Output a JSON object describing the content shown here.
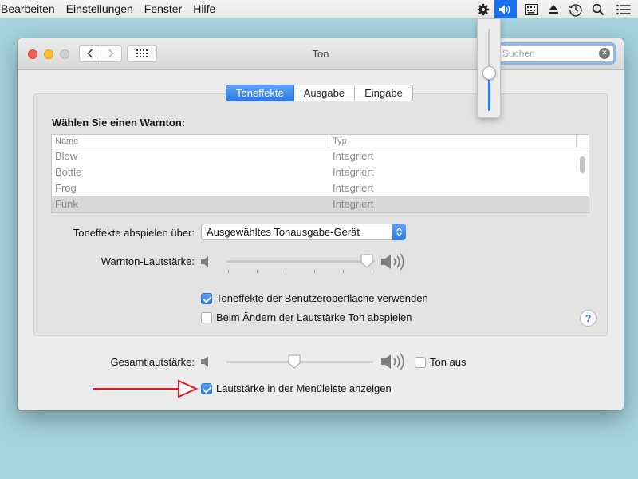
{
  "menubar": {
    "items": [
      "Bearbeiten",
      "Einstellungen",
      "Fenster",
      "Hilfe"
    ],
    "status_icons": [
      "gear-icon",
      "volume-icon",
      "keyboard-viewer-icon",
      "eject-icon",
      "time-machine-icon",
      "spotlight-search-icon",
      "notification-center-icon"
    ]
  },
  "volume_popup": {
    "level": 0.47
  },
  "window": {
    "title": "Ton",
    "search": {
      "placeholder": "Suchen",
      "value": ""
    }
  },
  "tabs": [
    {
      "label": "Toneffekte",
      "selected": true
    },
    {
      "label": "Ausgabe",
      "selected": false
    },
    {
      "label": "Eingabe",
      "selected": false
    }
  ],
  "alert_section": {
    "title": "Wählen Sie einen Warnton:",
    "columns": [
      "Name",
      "Typ"
    ],
    "rows": [
      {
        "name": "Blow",
        "type": "Integriert",
        "selected": false
      },
      {
        "name": "Bottle",
        "type": "Integriert",
        "selected": false
      },
      {
        "name": "Frog",
        "type": "Integriert",
        "selected": false
      },
      {
        "name": "Funk",
        "type": "Integriert",
        "selected": true
      }
    ]
  },
  "play_through": {
    "label": "Toneffekte abspielen über:",
    "selected": "Ausgewähltes Tonausgabe-Gerät"
  },
  "alert_volume": {
    "label": "Warnton-Lautstärke:",
    "level": 0.99
  },
  "ui_sounds": {
    "label": "Toneffekte der Benutzeroberfläche verwenden",
    "checked": true
  },
  "feedback": {
    "label": "Beim Ändern der Lautstärke Ton abspielen",
    "checked": false
  },
  "output_volume": {
    "label": "Gesamtlautstärke:",
    "level": 0.46
  },
  "mute": {
    "label": "Ton aus",
    "checked": false
  },
  "show_in_menubar": {
    "label": "Lautstärke in der Menüleiste anzeigen",
    "checked": true
  },
  "colors": {
    "accent": "#2b7ae6",
    "annotation_arrow": "#e0141b",
    "desktop": "#a6d3de"
  },
  "help": {
    "label": "?"
  }
}
